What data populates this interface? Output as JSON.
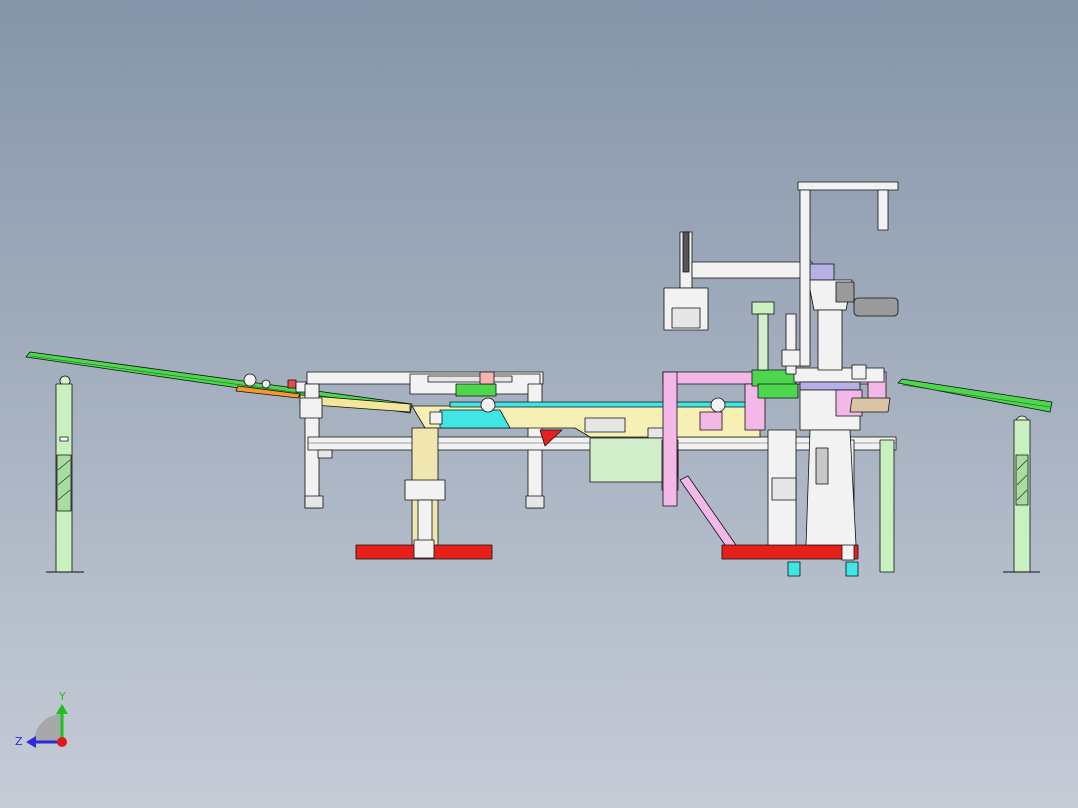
{
  "viewport": {
    "background_top": "#8595a9",
    "background_bottom": "#c6ccd7"
  },
  "colors": {
    "conveyor_green": "#4fd64f",
    "frame_white": "#f2f2f2",
    "support_green": "#c8f0c0",
    "base_red": "#e8201c",
    "plate_yellow": "#f6f0b4",
    "pink": "#f4b8e8",
    "cyan": "#40e6e6",
    "gearbox_green": "#d2eecb",
    "motor_gray": "#9a9a9a",
    "purple": "#b5b0e6"
  },
  "triad": {
    "y_label": "Y",
    "z_label": "Z",
    "y_color": "#1fbf1f",
    "z_color": "#2b2bd8",
    "x_color": "#e01818"
  }
}
